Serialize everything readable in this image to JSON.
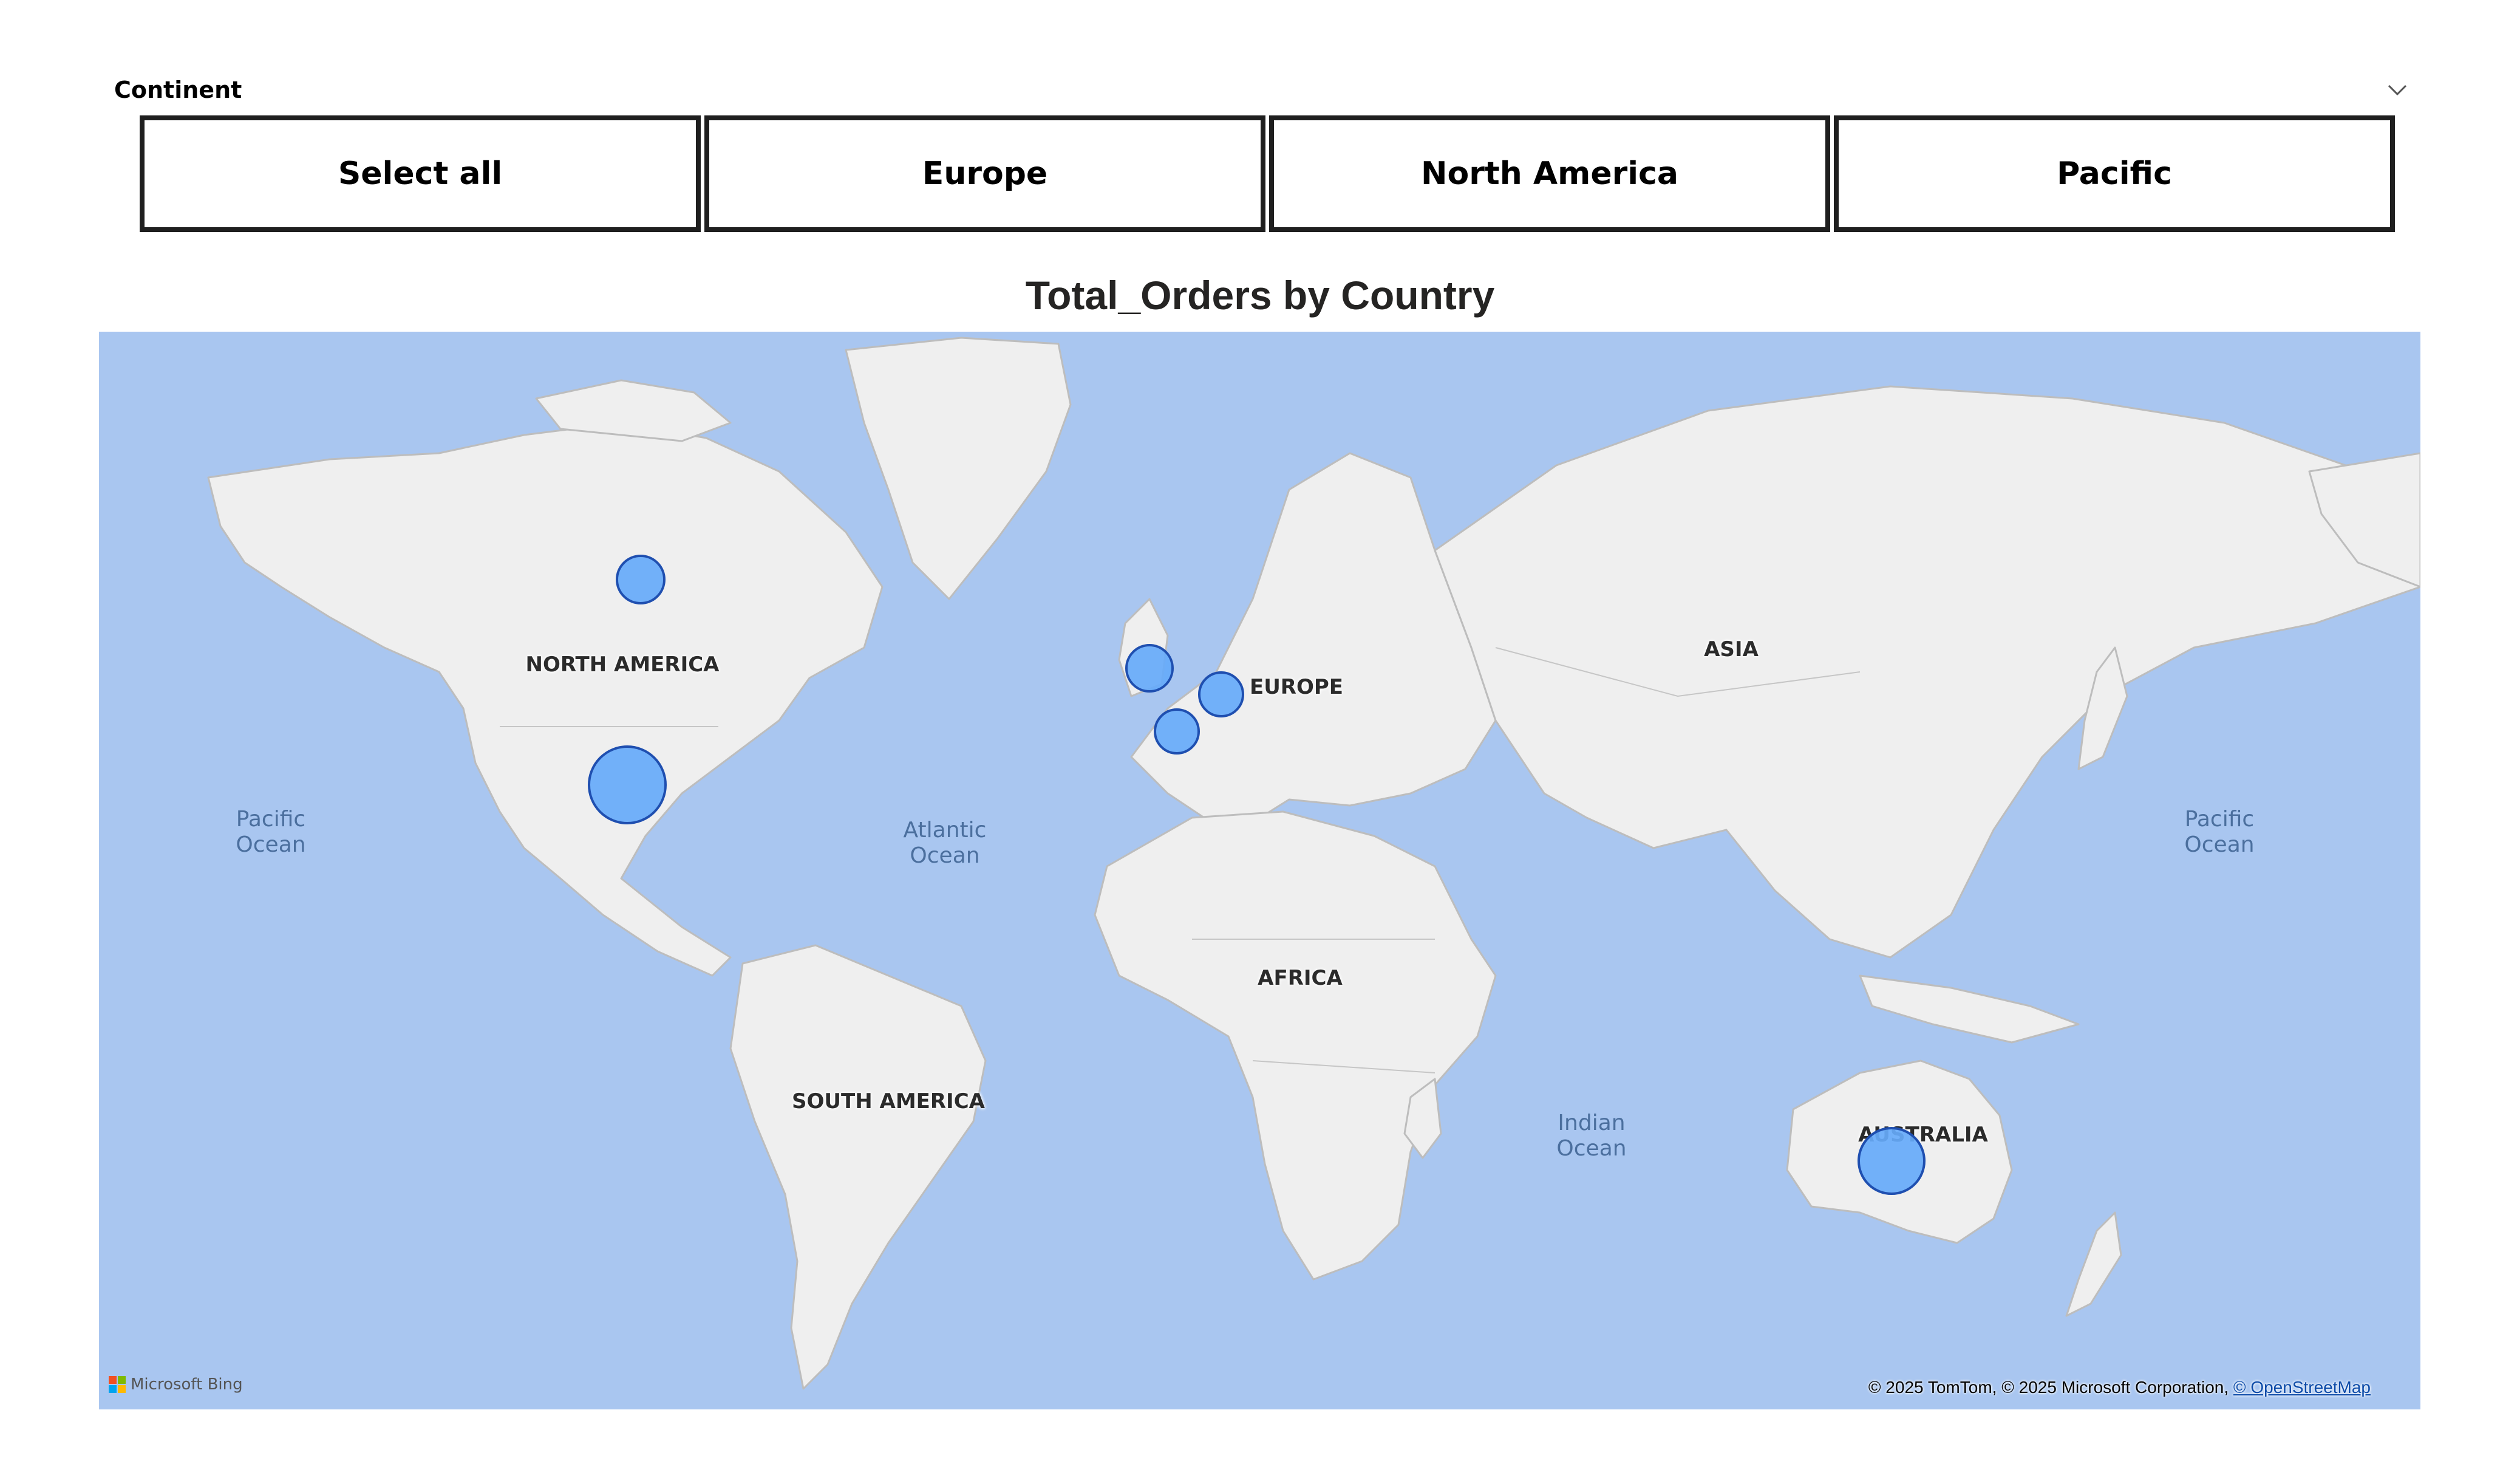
{
  "slicer": {
    "title": "Continent",
    "options": [
      "Select all",
      "Europe",
      "North America",
      "Pacific"
    ]
  },
  "visual": {
    "title": "Total_Orders by Country",
    "continent_labels": {
      "north_america": "NORTH AMERICA",
      "europe": "EUROPE",
      "asia": "ASIA",
      "africa": "AFRICA",
      "south_america": "SOUTH AMERICA",
      "australia": "AUSTRALIA"
    },
    "ocean_labels": {
      "pacific_west": "Pacific\nOcean",
      "atlantic": "Atlantic\nOcean",
      "indian": "Indian\nOcean",
      "pacific_east": "Pacific\nOcean"
    },
    "bubble_color": "#66aafa",
    "land_color": "#f0f0f0",
    "water_color": "#a9c6f0",
    "bubble_count": 6,
    "map_brand": "Microsoft Bing",
    "attribution": {
      "text": "© 2025 TomTom, © 2025 Microsoft Corporation,",
      "link": "© OpenStreetMap"
    }
  }
}
